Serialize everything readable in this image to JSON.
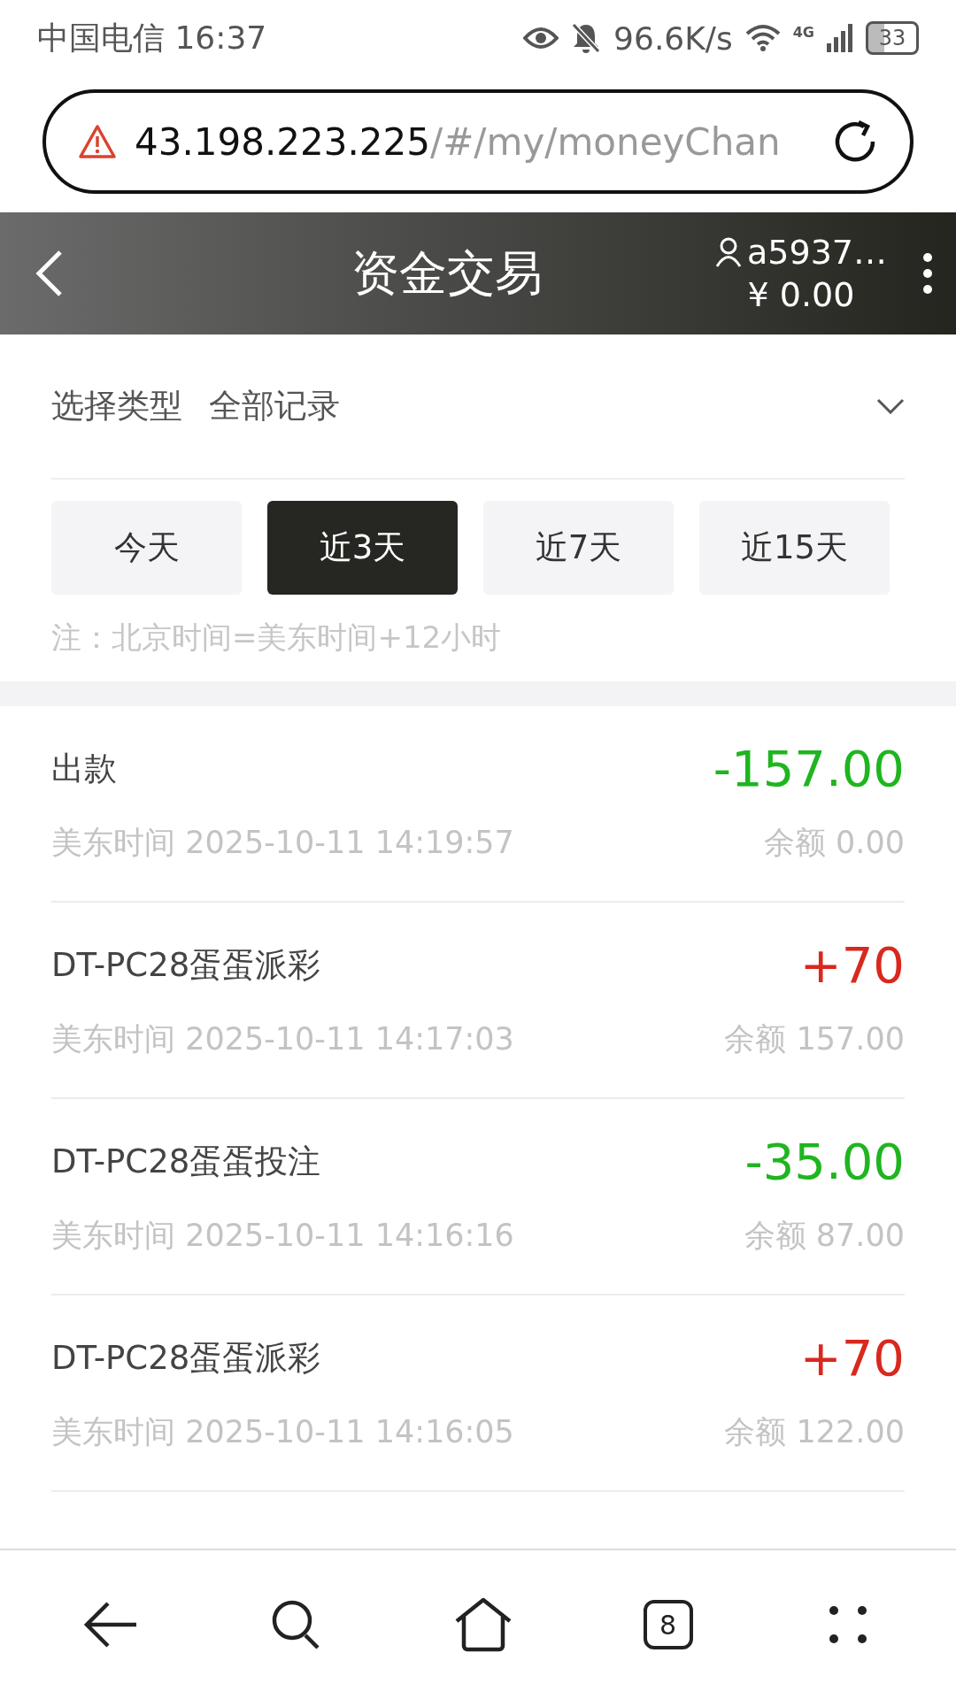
{
  "status_bar": {
    "carrier": "中国电信",
    "time": "16:37",
    "speed": "96.6K/s",
    "network": "4G",
    "battery": "33"
  },
  "address_bar": {
    "host": "43.198.223.225",
    "path": "/#/my/moneyChan"
  },
  "header": {
    "title": "资金交易",
    "username": "a5937…",
    "balance": "¥ 0.00"
  },
  "filter": {
    "label": "选择类型",
    "value": "全部记录"
  },
  "tabs": [
    {
      "label": "今天",
      "selected": false
    },
    {
      "label": "近3天",
      "selected": true
    },
    {
      "label": "近7天",
      "selected": false
    },
    {
      "label": "近15天",
      "selected": false
    }
  ],
  "note": "注：北京时间=美东时间+12小时",
  "records": [
    {
      "title": "出款",
      "amount": "-157.00",
      "color": "#1fb51f",
      "time": "美东时间 2025-10-11 14:19:57",
      "balance": "余额 0.00"
    },
    {
      "title": "DT-PC28蛋蛋派彩",
      "amount": "+70",
      "color": "#d9281e",
      "time": "美东时间 2025-10-11 14:17:03",
      "balance": "余额 157.00"
    },
    {
      "title": "DT-PC28蛋蛋投注",
      "amount": "-35.00",
      "color": "#1fb51f",
      "time": "美东时间 2025-10-11 14:16:16",
      "balance": "余额 87.00"
    },
    {
      "title": "DT-PC28蛋蛋派彩",
      "amount": "+70",
      "color": "#d9281e",
      "time": "美东时间 2025-10-11 14:16:05",
      "balance": "余额 122.00"
    }
  ],
  "bottom_nav": {
    "tab_count": "8"
  }
}
